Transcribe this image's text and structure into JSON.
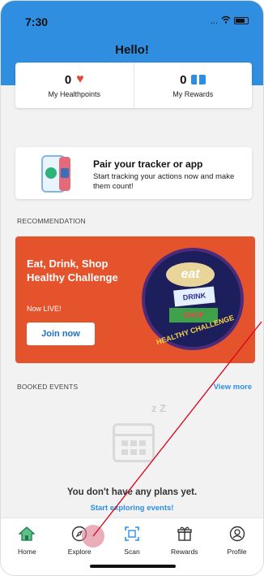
{
  "status_bar": {
    "time": "7:30",
    "signal": "...",
    "wifi": "wifi-icon"
  },
  "header": {
    "title": "Hello!",
    "bg_color": "#2f8ee0"
  },
  "points": {
    "healthpoints_value": "0",
    "healthpoints_label": "My Healthpoints",
    "rewards_value": "0",
    "rewards_label": "My Rewards"
  },
  "tracker": {
    "title": "Pair your tracker or app",
    "subtitle": "Start tracking your actions now and make them count!"
  },
  "recommendation": {
    "section_label": "RECOMMENDATION",
    "promo_title": "Eat, Drink, Shop Healthy Challenge",
    "promo_status": "Now LIVE!",
    "join_label": "Join now",
    "badge_eat": "eat",
    "badge_drink": "DRINK",
    "badge_shop": "SHOP",
    "badge_ring": "HEALTHY CHALLENGE",
    "promo_color": "#e4532b"
  },
  "booked_events": {
    "section_label": "BOOKED EVENTS",
    "view_more": "View more",
    "empty_zz": "z Z",
    "empty_title": "You don't have any plans yet.",
    "empty_link": "Start exploring events!"
  },
  "tabs": [
    {
      "label": "Home",
      "icon": "home-icon"
    },
    {
      "label": "Explore",
      "icon": "compass-icon"
    },
    {
      "label": "Scan",
      "icon": "scan-icon"
    },
    {
      "label": "Rewards",
      "icon": "gift-icon"
    },
    {
      "label": "Profile",
      "icon": "profile-icon"
    }
  ]
}
